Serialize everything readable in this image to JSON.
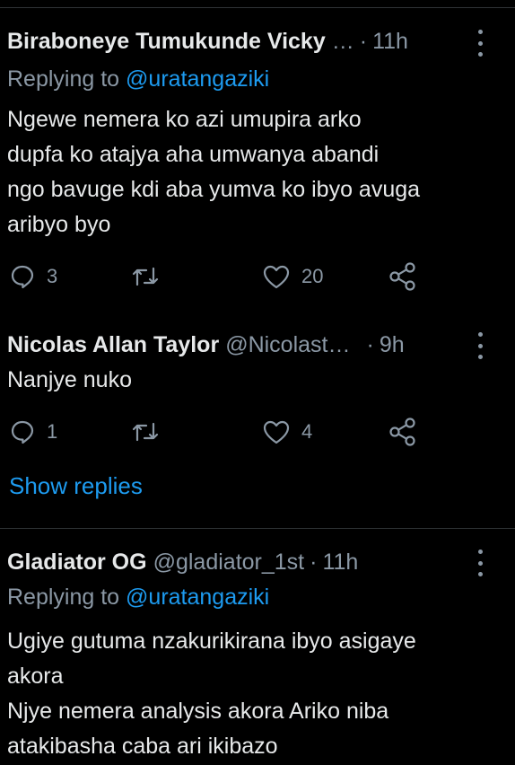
{
  "tweets": [
    {
      "name": "Biraboneye Tumukunde Vicky",
      "handle": "…",
      "time": "11h",
      "reply_prefix": "Replying to ",
      "reply_to": "@uratangaziki",
      "lines": [
        "Ngewe nemera ko azi umupira arko",
        "dupfa ko atajya aha umwanya abandi",
        "ngo bavuge kdi aba yumva ko ibyo avuga",
        "aribyo byo"
      ],
      "replies": "3",
      "retweets": "",
      "likes": "20"
    },
    {
      "name": "Nicolas Allan Taylor",
      "handle": "@Nicolast…",
      "time": "9h",
      "lines": [
        "Nanjye nuko"
      ],
      "replies": "1",
      "retweets": "",
      "likes": "4"
    },
    {
      "name": "Gladiator OG",
      "handle": "@gladiator_1st",
      "time": "11h",
      "reply_prefix": "Replying to ",
      "reply_to": "@uratangaziki",
      "lines": [
        "Ugiye gutuma nzakurikirana ibyo asigaye",
        "akora",
        "Njye nemera analysis akora Ariko niba",
        "atakibasha caba ari ikibazo"
      ]
    }
  ],
  "show_replies_label": "Show replies",
  "colors": {
    "background": "#000000",
    "text": "#e7e9ea",
    "secondary": "#8b98a5",
    "accent": "#1d9bf0",
    "divider": "#2f3336"
  },
  "icons": [
    "reply-icon",
    "retweet-icon",
    "like-icon",
    "share-icon",
    "more-icon"
  ]
}
